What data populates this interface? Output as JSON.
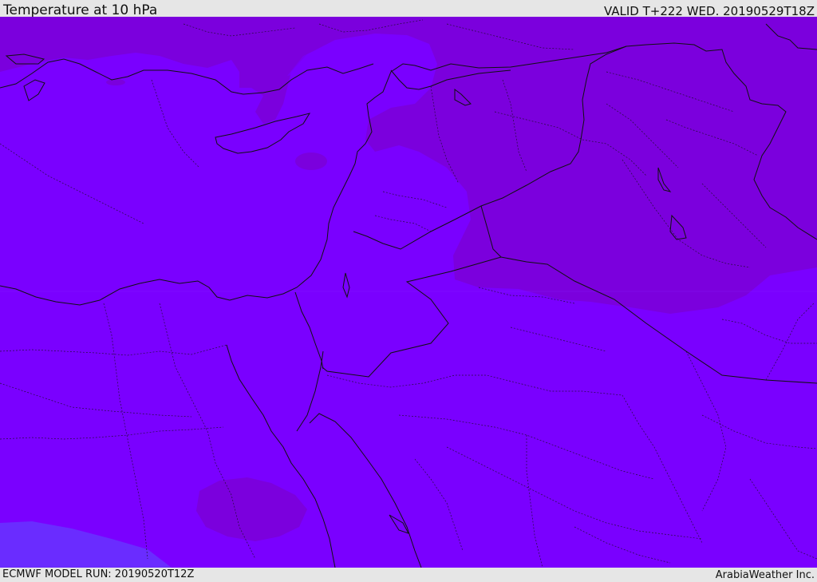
{
  "header": {
    "title": "Temperature at 10 hPa",
    "valid": "VALID T+222 WED. 20190529T18Z"
  },
  "footer": {
    "model_run": "ECMWF MODEL RUN: 20190520T12Z",
    "credit": "ArabiaWeather Inc."
  },
  "colors": {
    "field_base": "#7a00ff",
    "field_warm": "#7b00dd",
    "field_cool": "#6a2cff",
    "field_light": "#7f0aff",
    "border": "#111111",
    "bar_background": "#e6e6e6"
  }
}
